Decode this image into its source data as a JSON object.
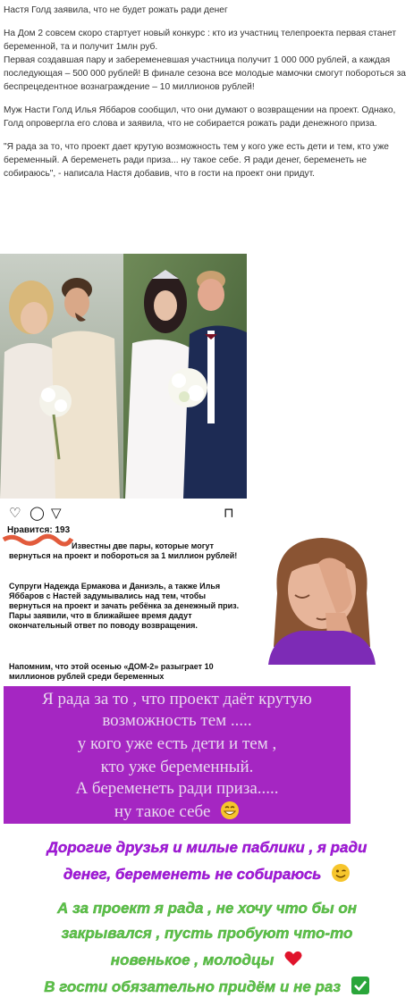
{
  "article": {
    "title": "Настя Голд заявила, что не будет рожать ради денег",
    "p1": "На Дом 2 совсем скоро стартует новый конкурс : кто из участниц телепроекта первая станет беременной, та и получит 1млн руб.",
    "p2": "Первая создавшая пару и забеременевшая участница получит 1 000 000 рублей, а каждая последующая – 500 000 рублей! В финале сезона все молодые мамочки смогут побороться за беспрецедентное вознаграждение – 10 миллионов рублей!",
    "p3": "Муж Насти Голд Илья Яббаров сообщил, что они думают о возвращении на проект. Однако, Голд опровергла его слова и заявила, что не собирается рожать ради денежного приза.",
    "p4": "\"Я рада за то, что проект дает крутую возможность тем у кого уже есть дети и тем, кто уже беременный. А беременеть ради приза... ну такое себе. Я ради денег, беременеть не собираюсь\", - написала Настя добавив, что в гости на проект они придут."
  },
  "insta": {
    "likes": "Нравится: 193",
    "caption1": "Известны две пары, которые могут вернуться на проект и побороться за 1 миллион рублей!",
    "caption2": "Супруги Надежда Ермакова и Даниэль, а также Илья Яббаров с Настей задумывались над тем, чтобы вернуться на проект и зачать ребёнка за денежный приз. Пары заявили, что в ближайшее время дадут окончательный ответ по поводу возвращения.",
    "caption3": "Напомним, что этой осенью «ДОМ-2» разыграет 10 миллионов рублей среди беременных"
  },
  "story": {
    "line1": "Я рада за то , что проект даёт крутую",
    "line2": "возможность тем .....",
    "line3": "у кого уже есть дети и тем ,",
    "line4": "кто уже беременный.",
    "line5": "А беременеть ради приза.....",
    "line6": "ну такое себе"
  },
  "quote": {
    "line1": "Дорогие друзья и милые паблики , я ради",
    "line2": "денег, беременеть не собираюсь",
    "line3": "А за проект я рада , не хочу что бы он",
    "line4": "закрывался , пусть пробуют что-то",
    "line5": "новенькое , молодцы",
    "line6": "В гости обязательно придём и не раз"
  },
  "colors": {
    "story_bg": "#a526c2",
    "purple_text": "#a21ad8",
    "green_text": "#5ec24a"
  }
}
